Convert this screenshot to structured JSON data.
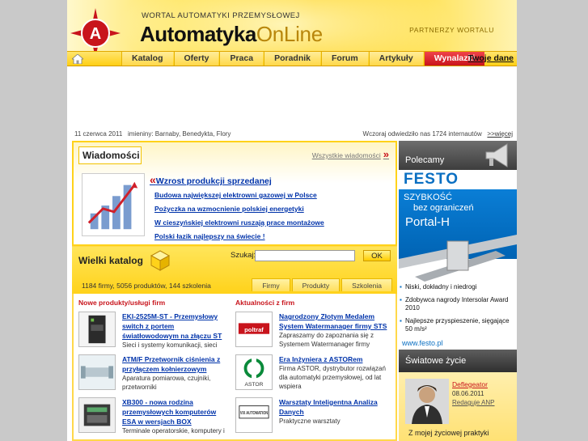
{
  "header": {
    "tagline": "WORTAL AUTOMATYKI PRZEMYSŁOWEJ",
    "brand_main": "Automatyka",
    "brand_suffix": "OnLine",
    "partners": "PARTNERZY WORTALU"
  },
  "nav": {
    "tabs": [
      {
        "label": "Katalog"
      },
      {
        "label": "Oferty"
      },
      {
        "label": "Praca"
      },
      {
        "label": "Poradnik"
      },
      {
        "label": "Forum"
      },
      {
        "label": "Artykuły"
      },
      {
        "label": "Wynalazki"
      }
    ],
    "account": "Twoje dane"
  },
  "dateline": {
    "date": "11 czerwca 2011",
    "nameday": "imieniny: Barnaby, Benedykta, Flory",
    "visits": "Wczoraj odwiedziło nas 1724 internautów",
    "more": ">>więcej"
  },
  "news": {
    "title": "Wiadomości",
    "all_link": "Wszystkie wiadomości",
    "lead": "Wzrost produkcji sprzedanej",
    "items": [
      "Budowa największej elektrowni gazowej w Polsce",
      "Pożyczka na wzmocnienie polskiej energetyki",
      "W cieszyńskiej elektrowni ruszają prace montażowe",
      "Polski łazik najlepszy na świecie !"
    ]
  },
  "catalog": {
    "title": "Wielki katalog",
    "search_label": "Szukaj:",
    "search_value": "",
    "ok": "OK",
    "stats": "1184 firmy, 5056 produktów, 144 szkolenia",
    "tabs": [
      "Firmy",
      "Produkty",
      "Szkolenia"
    ]
  },
  "products": {
    "heading": "Nowe produkty/usługi firm",
    "items": [
      {
        "title": "EKI-2525M-ST - Przemysłowy switch z portem światłowodowym na złączu ST",
        "desc": "Sieci i systemy komunikacji, sieci"
      },
      {
        "title": "ATM/F Przetwornik ciśnienia z przyłączem kołnierzowym",
        "desc": "Aparatura pomiarowa, czujniki, przetworniki"
      },
      {
        "title": "XB300 - nowa rodzina przemysłowych komputerów ESA w wersjach BOX",
        "desc": "Terminale operatorskie, komputery i"
      }
    ]
  },
  "company_news": {
    "heading": "Aktualności z firm",
    "items": [
      {
        "title": "Nagrodzony Złotym Medalem System Watermanager firmy STS",
        "desc": "Zapraszamy do zapoznania się z Systemem Watermanager firmy",
        "logo": "poltraf"
      },
      {
        "title": "Era Inżyniera z ASTORem",
        "desc": "Firma ASTOR, dystrybutor rozwiązań dla automatyki przemysłowej, od lat wspiera",
        "logo": "ASTOR"
      },
      {
        "title": "Warsztaty Inteligentna Analiza Danych",
        "desc": "Praktyczne warsztaty",
        "logo": "VIX AUTOMATION"
      }
    ]
  },
  "sidebar": {
    "polecamy": "Polecamy",
    "festo": {
      "logo": "FESTO",
      "line1": "SZYBKOŚĆ",
      "line2": "bez ograniczeń",
      "line3": "Portal-H",
      "bullets": [
        "Niski, dokładny i niedrogi",
        "Zdobywca nagrody Intersolar Award 2010",
        "Najlepsze przyspieszenie, sięgające 50 m/s²"
      ],
      "url": "www.festo.pl"
    },
    "swiat": "Światowe życie",
    "person": {
      "name": "Deflegeator",
      "date": "08.06.2011",
      "role": "Redaguje ANP",
      "quote": "Z mojej życiowej praktyki"
    }
  },
  "colors": {
    "yellow": "#ffd21a",
    "red": "#c8141c",
    "link": "#0033aa",
    "festo_blue": "#0a6fc2"
  }
}
